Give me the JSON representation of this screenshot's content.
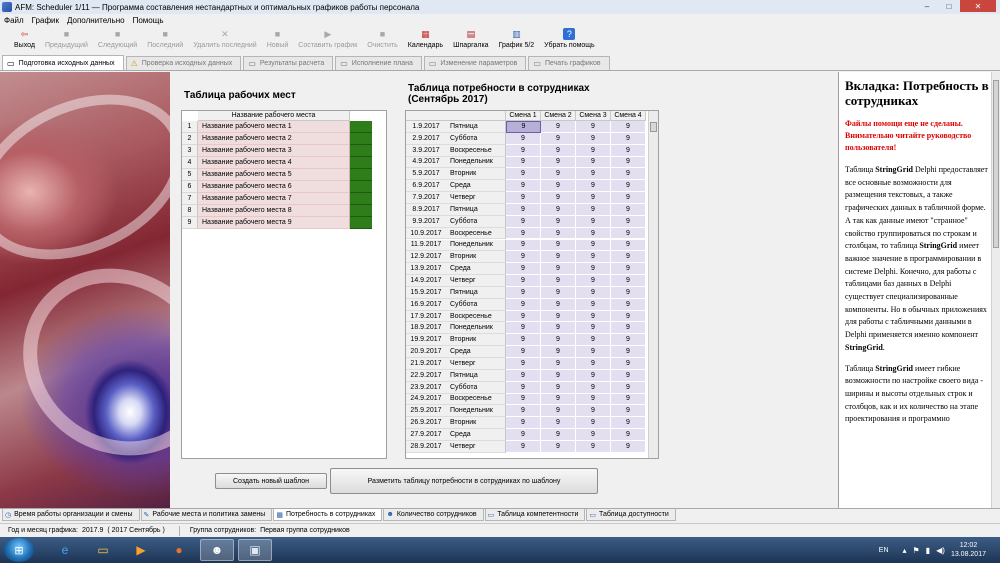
{
  "window": {
    "title": "AFM: Scheduler 1/11 — Программа составления  нестандартных и оптимальных графиков работы персонала",
    "controls": [
      "–",
      "□",
      "✕"
    ]
  },
  "menu": [
    "Файл",
    "График",
    "Дополнительно",
    "Помощь"
  ],
  "toolbar": [
    {
      "label": "Выход",
      "icon": "exit-icon",
      "glyph": "⇦",
      "enabled": true
    },
    {
      "label": "Предыдущий",
      "icon": "prev-icon",
      "glyph": "■",
      "enabled": false
    },
    {
      "label": "Следующий",
      "icon": "next-icon",
      "glyph": "■",
      "enabled": false
    },
    {
      "label": "Последний",
      "icon": "last-icon",
      "glyph": "■",
      "enabled": false
    },
    {
      "label": "Удалить последний",
      "icon": "delete-icon",
      "glyph": "✕",
      "enabled": false
    },
    {
      "label": "Новый",
      "icon": "new-icon",
      "glyph": "■",
      "enabled": false
    },
    {
      "label": "Составить график",
      "icon": "play-icon",
      "glyph": "▶",
      "enabled": false
    },
    {
      "label": "Очистить",
      "icon": "clear-icon",
      "glyph": "■",
      "enabled": false
    },
    {
      "label": "Календарь",
      "icon": "calendar-icon",
      "glyph": "▦",
      "enabled": true
    },
    {
      "label": "Шпаргалка",
      "icon": "cheatsheet-icon",
      "glyph": "▤",
      "enabled": true
    },
    {
      "label": "График 5/2",
      "icon": "chart-icon",
      "glyph": "▥",
      "enabled": true
    },
    {
      "label": "Убрать помощь",
      "icon": "help-icon",
      "glyph": "?",
      "enabled": true
    }
  ],
  "top_tabs": [
    {
      "label": "Подготовка исходных данных",
      "icon": "doc-icon",
      "glyph": "▭",
      "active": true
    },
    {
      "label": "Проверка исходных данных",
      "icon": "warning-icon",
      "glyph": "⚠",
      "active": false
    },
    {
      "label": "Результаты расчета",
      "icon": "results-icon",
      "glyph": "▭",
      "active": false
    },
    {
      "label": "Исполнение плана",
      "icon": "execution-icon",
      "glyph": "▭",
      "active": false
    },
    {
      "label": "Изменение параметров",
      "icon": "params-icon",
      "glyph": "▭",
      "active": false
    },
    {
      "label": "Печать графиков",
      "icon": "print-icon",
      "glyph": "▭",
      "active": false
    }
  ],
  "workplaces": {
    "title": "Таблица рабочих мест",
    "column_header": "Название рабочего места",
    "rows": [
      {
        "num": "1",
        "name": "Название рабочего места 1"
      },
      {
        "num": "2",
        "name": "Название рабочего места 2"
      },
      {
        "num": "3",
        "name": "Название рабочего места 3"
      },
      {
        "num": "4",
        "name": "Название рабочего места 4"
      },
      {
        "num": "5",
        "name": "Название рабочего места 5"
      },
      {
        "num": "6",
        "name": "Название рабочего места 6"
      },
      {
        "num": "7",
        "name": "Название рабочего места 7"
      },
      {
        "num": "8",
        "name": "Название рабочего места 8"
      },
      {
        "num": "9",
        "name": "Название рабочего места 9"
      }
    ],
    "color_hex": "#2e7d1a"
  },
  "staff_need": {
    "title_line1": "Таблица потребности в сотрудниках",
    "title_line2": "(Сентябрь 2017)",
    "shift_headers": [
      "Смена 1",
      "Смена 2",
      "Смена 3",
      "Смена 4"
    ],
    "rows": [
      {
        "date": "1.9.2017",
        "weekday": "Пятница",
        "values": [
          "9",
          "9",
          "9",
          "9"
        ]
      },
      {
        "date": "2.9.2017",
        "weekday": "Суббота",
        "values": [
          "9",
          "9",
          "9",
          "9"
        ]
      },
      {
        "date": "3.9.2017",
        "weekday": "Воскресенье",
        "values": [
          "9",
          "9",
          "9",
          "9"
        ]
      },
      {
        "date": "4.9.2017",
        "weekday": "Понедельник",
        "values": [
          "9",
          "9",
          "9",
          "9"
        ]
      },
      {
        "date": "5.9.2017",
        "weekday": "Вторник",
        "values": [
          "9",
          "9",
          "9",
          "9"
        ]
      },
      {
        "date": "6.9.2017",
        "weekday": "Среда",
        "values": [
          "9",
          "9",
          "9",
          "9"
        ]
      },
      {
        "date": "7.9.2017",
        "weekday": "Четверг",
        "values": [
          "9",
          "9",
          "9",
          "9"
        ]
      },
      {
        "date": "8.9.2017",
        "weekday": "Пятница",
        "values": [
          "9",
          "9",
          "9",
          "9"
        ]
      },
      {
        "date": "9.9.2017",
        "weekday": "Суббота",
        "values": [
          "9",
          "9",
          "9",
          "9"
        ]
      },
      {
        "date": "10.9.2017",
        "weekday": "Воскресенье",
        "values": [
          "9",
          "9",
          "9",
          "9"
        ]
      },
      {
        "date": "11.9.2017",
        "weekday": "Понедельник",
        "values": [
          "9",
          "9",
          "9",
          "9"
        ]
      },
      {
        "date": "12.9.2017",
        "weekday": "Вторник",
        "values": [
          "9",
          "9",
          "9",
          "9"
        ]
      },
      {
        "date": "13.9.2017",
        "weekday": "Среда",
        "values": [
          "9",
          "9",
          "9",
          "9"
        ]
      },
      {
        "date": "14.9.2017",
        "weekday": "Четверг",
        "values": [
          "9",
          "9",
          "9",
          "9"
        ]
      },
      {
        "date": "15.9.2017",
        "weekday": "Пятница",
        "values": [
          "9",
          "9",
          "9",
          "9"
        ]
      },
      {
        "date": "16.9.2017",
        "weekday": "Суббота",
        "values": [
          "9",
          "9",
          "9",
          "9"
        ]
      },
      {
        "date": "17.9.2017",
        "weekday": "Воскресенье",
        "values": [
          "9",
          "9",
          "9",
          "9"
        ]
      },
      {
        "date": "18.9.2017",
        "weekday": "Понедельник",
        "values": [
          "9",
          "9",
          "9",
          "9"
        ]
      },
      {
        "date": "19.9.2017",
        "weekday": "Вторник",
        "values": [
          "9",
          "9",
          "9",
          "9"
        ]
      },
      {
        "date": "20.9.2017",
        "weekday": "Среда",
        "values": [
          "9",
          "9",
          "9",
          "9"
        ]
      },
      {
        "date": "21.9.2017",
        "weekday": "Четверг",
        "values": [
          "9",
          "9",
          "9",
          "9"
        ]
      },
      {
        "date": "22.9.2017",
        "weekday": "Пятница",
        "values": [
          "9",
          "9",
          "9",
          "9"
        ]
      },
      {
        "date": "23.9.2017",
        "weekday": "Суббота",
        "values": [
          "9",
          "9",
          "9",
          "9"
        ]
      },
      {
        "date": "24.9.2017",
        "weekday": "Воскресенье",
        "values": [
          "9",
          "9",
          "9",
          "9"
        ]
      },
      {
        "date": "25.9.2017",
        "weekday": "Понедельник",
        "values": [
          "9",
          "9",
          "9",
          "9"
        ]
      },
      {
        "date": "26.9.2017",
        "weekday": "Вторник",
        "values": [
          "9",
          "9",
          "9",
          "9"
        ]
      },
      {
        "date": "27.9.2017",
        "weekday": "Среда",
        "values": [
          "9",
          "9",
          "9",
          "9"
        ]
      },
      {
        "date": "28.9.2017",
        "weekday": "Четверг",
        "values": [
          "9",
          "9",
          "9",
          "9"
        ]
      }
    ]
  },
  "buttons": {
    "new_template": "Создать новый шаблон",
    "apply_template": "Разметить таблицу потребности в сотрудниках по шаблону"
  },
  "help": {
    "heading": "Вкладка: Потребность в сотрудниках",
    "warning": "Файлы помощи еще не сделаны. Внимательно читайте руководство пользователя!",
    "p1_pre": "Таблица ",
    "p1_strong": "StringGrid",
    "p1_rest": " Delphi предоставляет все основные возможности для размещения текстовых, а также графических данных в табличной форме. А так как данные имеют \"странное\" свойство группироваться по строкам и столбцам, то таблица ",
    "p1_strong2": "StringGrid",
    "p1_rest2": " имеет важное значение в программировании в системе Delphi. Конечно, для работы с таблицами баз данных в Delphi существует специализированные компоненты. Но в обычных приложениях для работы с табличными данными в Delphi применяется именно компонент ",
    "p1_strong3": "StringGrid",
    "p1_end": ".",
    "p2_pre": "Таблица ",
    "p2_strong": "StringGrid",
    "p2_rest": " имеет гибкие возможности по настройке своего вида - ширины и высоты отдельных строк и столбцов, как и их количество на этапе проектирования и программно"
  },
  "bottom_tabs": [
    {
      "label": "Время работы организации и смены",
      "icon": "clock-icon",
      "glyph": "◷",
      "active": false
    },
    {
      "label": "Рабочие места и политика замены",
      "icon": "workplace-icon",
      "glyph": "✎",
      "active": false
    },
    {
      "label": "Потребность в сотрудниках",
      "icon": "grid-icon",
      "glyph": "▦",
      "active": true
    },
    {
      "label": "Количество сотрудников",
      "icon": "person-icon",
      "glyph": "☻",
      "active": false
    },
    {
      "label": "Таблица компетентности",
      "icon": "table-icon",
      "glyph": "▭",
      "active": false
    },
    {
      "label": "Таблица доступности",
      "icon": "availability-icon",
      "glyph": "▭",
      "active": false
    }
  ],
  "status": {
    "period_label": "Год и месяц графика:",
    "period_value": "2017.9",
    "period_text": "( 2017  Сентябрь )",
    "group_label": "Группа сотрудников:",
    "group_value": "Первая группа сотрудников"
  },
  "taskbar": {
    "apps": [
      {
        "name": "ie-icon",
        "glyph": "e",
        "color": "#3fa9f5",
        "active": false
      },
      {
        "name": "explorer-icon",
        "glyph": "▭",
        "color": "#f4c542",
        "active": false
      },
      {
        "name": "media-icon",
        "glyph": "▶",
        "color": "#f7a12b",
        "active": false
      },
      {
        "name": "firefox-icon",
        "glyph": "●",
        "color": "#e8712b",
        "active": false
      },
      {
        "name": "user-app-icon",
        "glyph": "☻",
        "color": "#ffffff",
        "active": true
      },
      {
        "name": "scheduler-app-icon",
        "glyph": "▣",
        "color": "#dfe8f3",
        "active": true
      }
    ],
    "lang": "EN",
    "time": "12:02",
    "date": "13.08.2017"
  }
}
